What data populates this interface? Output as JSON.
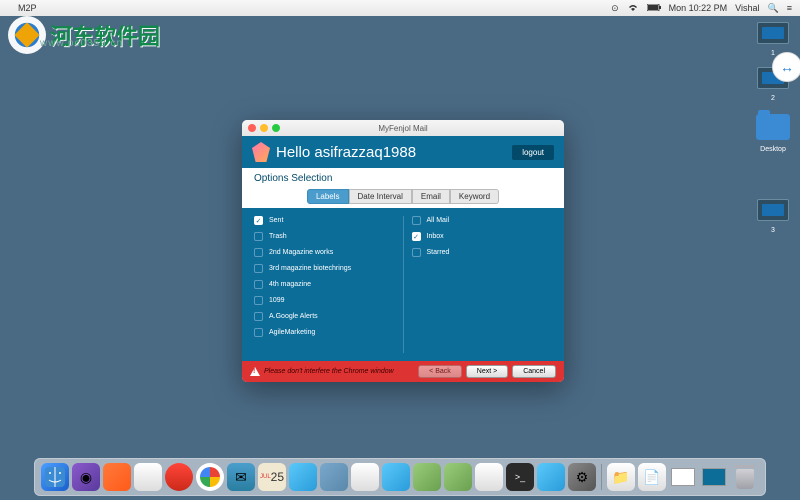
{
  "menubar": {
    "app_name": "M2P",
    "time": "Mon 10:22 PM",
    "user": "Vishal"
  },
  "watermark": {
    "text": "河东软件园",
    "url": "www.pc0359.cn"
  },
  "desktop": {
    "thumb1_label": "1",
    "thumb2_label": "2",
    "folder_label": "Desktop",
    "thumb3_label": "3"
  },
  "window": {
    "title": "MyFenjol Mail",
    "greeting": "Hello asifrazzaq1988",
    "logout_label": "logout",
    "section": "Options Selection",
    "tabs": [
      "Labels",
      "Date Interval",
      "Email",
      "Keyword"
    ],
    "active_tab": 0,
    "left_items": [
      {
        "label": "Sent",
        "checked": true
      },
      {
        "label": "Trash",
        "checked": false
      },
      {
        "label": "2nd Magazine works",
        "checked": false
      },
      {
        "label": "3rd magazine biotechrings",
        "checked": false
      },
      {
        "label": "4th magazine",
        "checked": false
      },
      {
        "label": "1099",
        "checked": false
      },
      {
        "label": "A.Google Alerts",
        "checked": false
      },
      {
        "label": "AgileMarketing",
        "checked": false
      }
    ],
    "right_items": [
      {
        "label": "All Mail",
        "checked": false
      },
      {
        "label": "Inbox",
        "checked": true
      },
      {
        "label": "Starred",
        "checked": false
      }
    ],
    "warning": "Please don't interfere the Chrome window",
    "buttons": {
      "back": "< Back",
      "next": "Next >",
      "cancel": "Cancel"
    }
  },
  "calendar_day": "25"
}
